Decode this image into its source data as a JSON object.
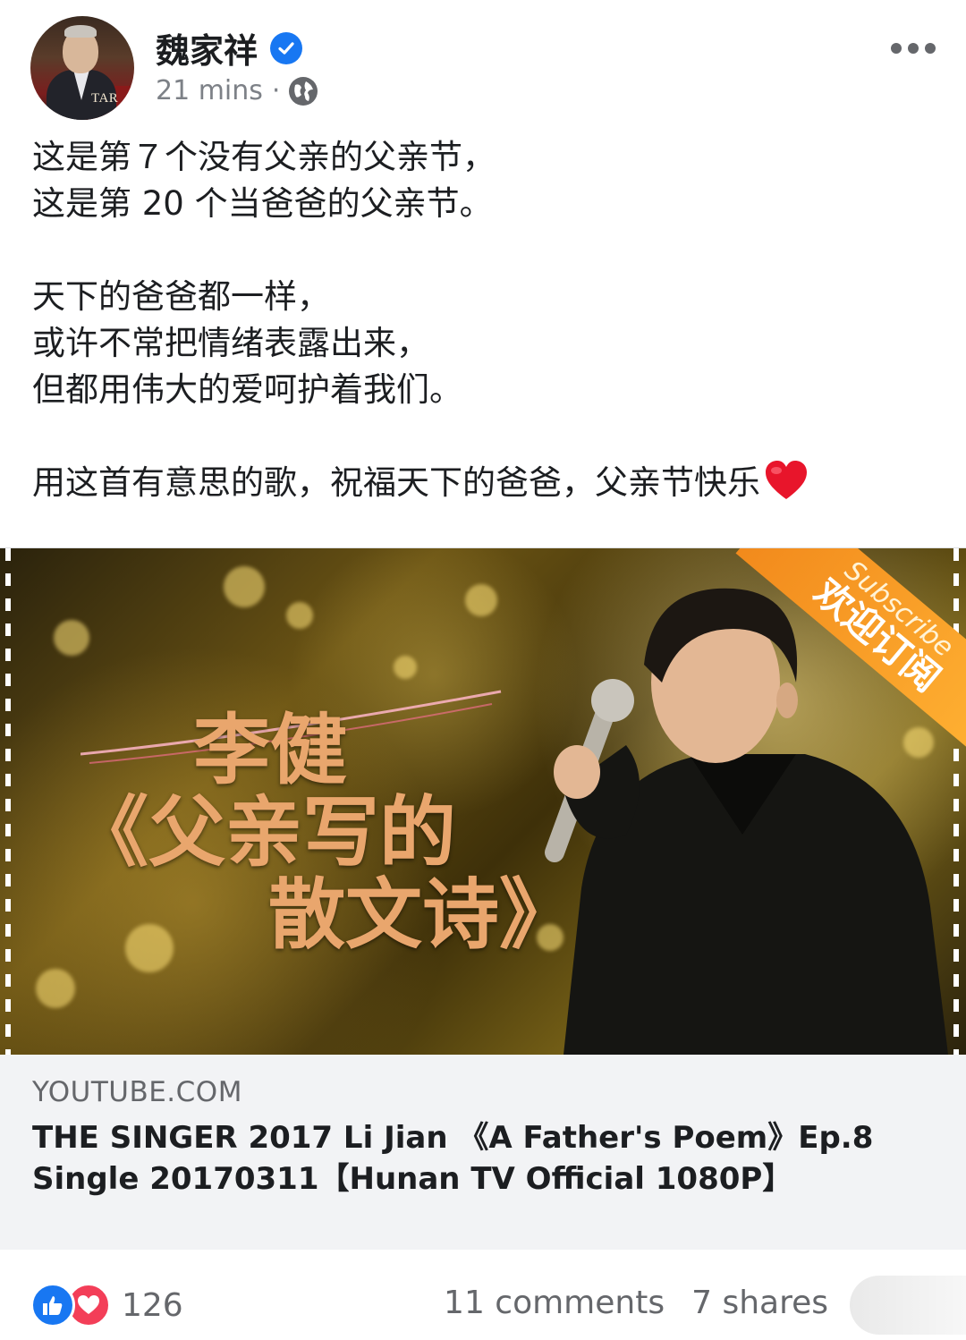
{
  "post": {
    "author_name": "魏家祥",
    "time": "21 mins",
    "separator": "·",
    "avatar_text": "TAR",
    "text_lines": [
      "这是第７个没有父亲的父亲节，",
      "这是第 20 个当爸爸的父亲节。",
      "",
      "天下的爸爸都一样，",
      "或许不常把情绪表露出来，",
      "但都用伟大的爱呵护着我们。",
      "",
      "用这首有意思的歌，祝福天下的爸爸，父亲节快乐"
    ]
  },
  "preview": {
    "art_line1": "李健",
    "art_line2": "《父亲写的",
    "art_line3": "散文诗》",
    "ribbon_en": "Subscribe",
    "ribbon_zh": "欢迎订阅",
    "domain": "YOUTUBE.COM",
    "title": "THE SINGER 2017 Li Jian 《A Father's Poem》Ep.8 Single 20170311【Hunan TV Official 1080P】"
  },
  "footer": {
    "reaction_count": "126",
    "comments": "11 comments",
    "shares": "7 shares"
  },
  "icons": {
    "verified": "verified-badge-icon",
    "globe": "globe-icon",
    "more": "more-options-icon",
    "like": "like-reaction-icon",
    "love": "love-reaction-icon",
    "heart": "red-heart-emoji"
  },
  "colors": {
    "brand_blue": "#1877f2",
    "love_red": "#f33e58",
    "meta_gray": "#65676b",
    "title_art": "#e9a66d",
    "ribbon": "#f28a1c"
  }
}
